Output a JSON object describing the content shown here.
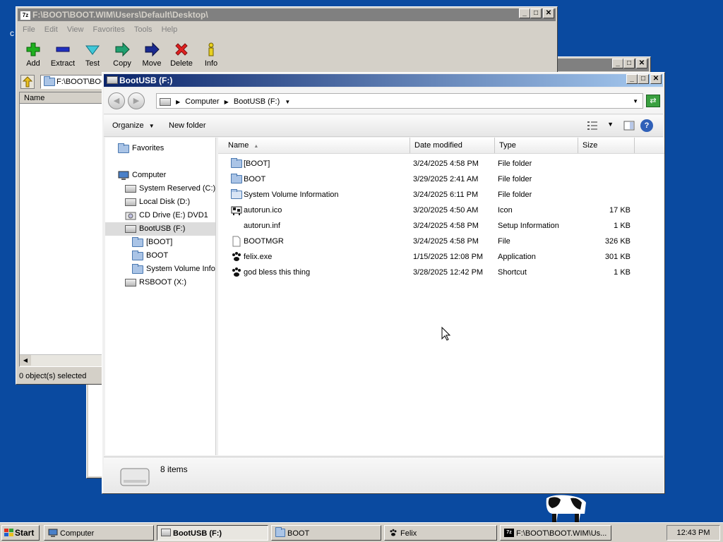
{
  "desktop": {
    "edge_char": "c"
  },
  "sevenzip": {
    "logo": "7z",
    "title": "F:\\BOOT\\BOOT.WIM\\Users\\Default\\Desktop\\",
    "menu": [
      "File",
      "Edit",
      "View",
      "Favorites",
      "Tools",
      "Help"
    ],
    "toolbar": [
      {
        "label": "Add",
        "icon": "add-icon"
      },
      {
        "label": "Extract",
        "icon": "extract-icon"
      },
      {
        "label": "Test",
        "icon": "test-icon"
      },
      {
        "label": "Copy",
        "icon": "copy-icon"
      },
      {
        "label": "Move",
        "icon": "move-icon"
      },
      {
        "label": "Delete",
        "icon": "delete-icon"
      },
      {
        "label": "Info",
        "icon": "info-icon"
      }
    ],
    "address": "F:\\BOOT\\BOO",
    "column_name": "Name",
    "status": "0 object(s) selected"
  },
  "explorer": {
    "title": "BootUSB (F:)",
    "breadcrumb": [
      "Computer",
      "BootUSB (F:)"
    ],
    "commands": {
      "organize": "Organize",
      "new_folder": "New folder"
    },
    "nav": [
      {
        "label": "Favorites",
        "icon": "favorites-folder-icon",
        "indent": 0
      },
      {
        "label": "Computer",
        "icon": "computer-icon",
        "indent": 0
      },
      {
        "label": "System Reserved (C:)",
        "icon": "drive-icon",
        "indent": 1
      },
      {
        "label": "Local Disk (D:)",
        "icon": "drive-icon",
        "indent": 1
      },
      {
        "label": "CD Drive (E:) DVD1",
        "icon": "cd-drive-icon",
        "indent": 1
      },
      {
        "label": "BootUSB (F:)",
        "icon": "usb-drive-icon",
        "indent": 1,
        "selected": true
      },
      {
        "label": "[BOOT]",
        "icon": "folder-icon",
        "indent": 2
      },
      {
        "label": "BOOT",
        "icon": "folder-icon",
        "indent": 2
      },
      {
        "label": "System Volume Information",
        "icon": "folder-icon",
        "indent": 2
      },
      {
        "label": "RSBOOT (X:)",
        "icon": "drive-icon",
        "indent": 1
      }
    ],
    "columns": {
      "name": "Name",
      "date": "Date modified",
      "type": "Type",
      "size": "Size"
    },
    "files": [
      {
        "name": "[BOOT]",
        "date": "3/24/2025 4:58 PM",
        "type": "File folder",
        "size": "",
        "icon": "folder-icon"
      },
      {
        "name": "BOOT",
        "date": "3/29/2025 2:41 AM",
        "type": "File folder",
        "size": "",
        "icon": "folder-icon"
      },
      {
        "name": "System Volume Information",
        "date": "3/24/2025 6:11 PM",
        "type": "File folder",
        "size": "",
        "icon": "folder-icon"
      },
      {
        "name": "autorun.ico",
        "date": "3/20/2025 4:50 AM",
        "type": "Icon",
        "size": "17 KB",
        "icon": "cow-icon"
      },
      {
        "name": "autorun.inf",
        "date": "3/24/2025 4:58 PM",
        "type": "Setup Information",
        "size": "1 KB",
        "icon": "settings-file-icon"
      },
      {
        "name": "BOOTMGR",
        "date": "3/24/2025 4:58 PM",
        "type": "File",
        "size": "326 KB",
        "icon": "file-icon"
      },
      {
        "name": "felix.exe",
        "date": "1/15/2025 12:08 PM",
        "type": "Application",
        "size": "301 KB",
        "icon": "paw-icon"
      },
      {
        "name": "god bless this thing",
        "date": "3/28/2025 12:42 PM",
        "type": "Shortcut",
        "size": "1 KB",
        "icon": "paw-icon"
      }
    ],
    "item_count": "8 items"
  },
  "taskbar": {
    "start": "Start",
    "tasks": [
      {
        "label": "Computer",
        "icon": "computer-icon"
      },
      {
        "label": "BootUSB (F:)",
        "icon": "usb-drive-icon",
        "active": true
      },
      {
        "label": "BOOT",
        "icon": "folder-icon"
      },
      {
        "label": "Felix",
        "icon": "paw-icon"
      },
      {
        "label": "F:\\BOOT\\BOOT.WIM\\Us...",
        "icon": "sevenzip-icon"
      }
    ],
    "clock": "12:43 PM"
  }
}
